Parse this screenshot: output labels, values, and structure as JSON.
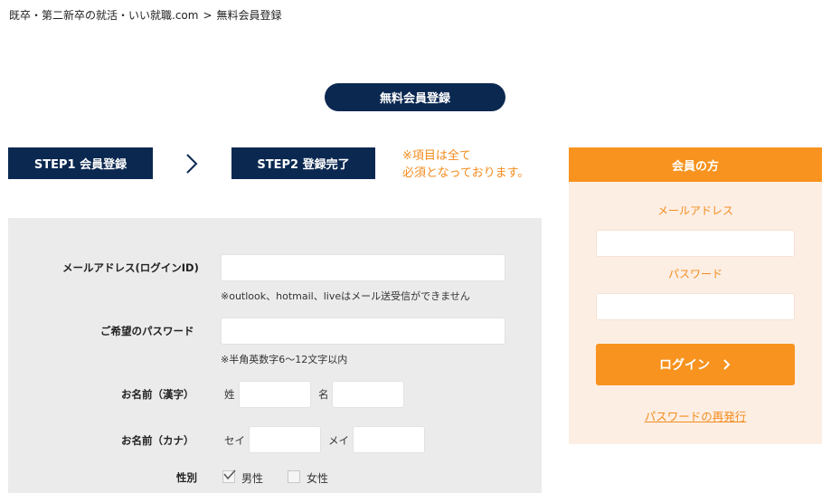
{
  "breadcrumb": {
    "home": "既卒・第二新卒の就活・いい就職.com",
    "separator": ">",
    "current": "無料会員登録"
  },
  "title": "無料会員登録",
  "steps": [
    {
      "label": "STEP1 会員登録"
    },
    {
      "label": "STEP2 登録完了"
    }
  ],
  "required_note": {
    "line1": "※項目は全て",
    "line2": "必須となっております。"
  },
  "form": {
    "email": {
      "label": "メールアドレス(ログインID)",
      "value": "",
      "hint": "※outlook、hotmail、liveはメール送受信ができません"
    },
    "password": {
      "label": "ご希望のパスワード",
      "value": "",
      "hint": "※半角英数字6〜12文字以内"
    },
    "name_kanji": {
      "label": "お名前（漢字）",
      "last_label": "姓",
      "first_label": "名",
      "last_value": "",
      "first_value": ""
    },
    "name_kana": {
      "label": "お名前（カナ）",
      "last_label": "セイ",
      "first_label": "メイ",
      "last_value": "",
      "first_value": ""
    },
    "gender": {
      "label": "性別",
      "options": [
        "男性",
        "女性"
      ],
      "selected": "男性"
    }
  },
  "member": {
    "header": "会員の方",
    "email_label": "メールアドレス",
    "email_value": "",
    "password_label": "パスワード",
    "password_value": "",
    "login_label": "ログイン",
    "reissue_link": "パスワードの再発行"
  },
  "colors": {
    "navy": "#0b2850",
    "orange": "#f7931e",
    "orange_text": "#f28c1e",
    "panel_gray": "#ebebeb",
    "panel_peach": "#fdeee3"
  },
  "icons": {
    "step_arrow": "chevron-right-icon",
    "login_chevron": "chevron-right-icon",
    "gender_check": "checkmark-icon"
  }
}
